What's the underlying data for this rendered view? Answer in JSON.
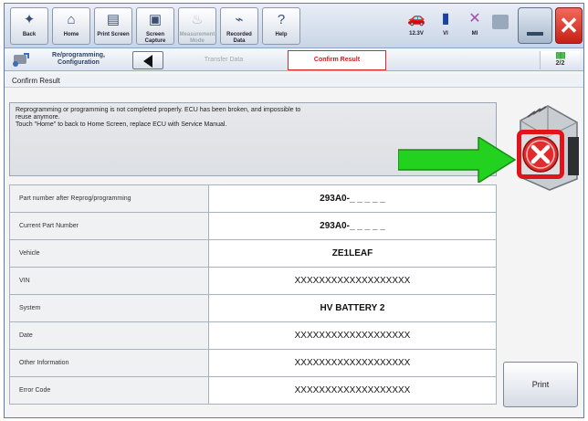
{
  "toolbar": {
    "buttons": [
      {
        "icon": "star-icon",
        "label": "Back"
      },
      {
        "icon": "home-icon",
        "label": "Home"
      },
      {
        "icon": "print-screen-icon",
        "label": "Print Screen"
      },
      {
        "icon": "screen-capture-icon",
        "label": "Screen Capture"
      },
      {
        "icon": "measurement-mode-icon",
        "label": "Measurement Mode"
      },
      {
        "icon": "recorded-data-icon",
        "label": "Recorded Data"
      },
      {
        "icon": "help-icon",
        "label": "Help"
      }
    ],
    "status": {
      "battery_voltage": "12.3V",
      "vi_label": "VI",
      "mi_label": "MI"
    }
  },
  "breadcrumb": {
    "title": "Re/programming, Configuration",
    "previous_step": "Transfer Data",
    "current_step": "Confirm Result",
    "page": "2/2"
  },
  "section": {
    "title": "Confirm Result"
  },
  "message": {
    "line1": "Reprogramming or programming is not completed properly. ECU has been broken, and impossible to\nreuse anymore.",
    "line2": "Touch \"Home\" to back to Home Screen, replace ECU with Service Manual."
  },
  "results": [
    {
      "label": "Part number after Reprog/programming",
      "value": "293A0-_ _ _ _ _",
      "bold": true
    },
    {
      "label": "Current Part Number",
      "value": "293A0-_ _ _ _ _",
      "bold": true
    },
    {
      "label": "Vehicle",
      "value": "ZE1LEAF",
      "bold": true
    },
    {
      "label": "VIN",
      "value": "XXXXXXXXXXXXXXXXXXX",
      "bold": false
    },
    {
      "label": "System",
      "value": "HV BATTERY 2",
      "bold": true
    },
    {
      "label": "Date",
      "value": "XXXXXXXXXXXXXXXXXXX",
      "bold": false
    },
    {
      "label": "Other Information",
      "value": "XXXXXXXXXXXXXXXXXXX",
      "bold": false
    },
    {
      "label": "Error Code",
      "value": "XXXXXXXXXXXXXXXXXXX",
      "bold": false
    }
  ],
  "print_button": {
    "label": "Print"
  },
  "colors": {
    "highlight_red": "#e2141b",
    "arrow_green": "#22d21f",
    "accent_blue": "#5a7fae"
  }
}
